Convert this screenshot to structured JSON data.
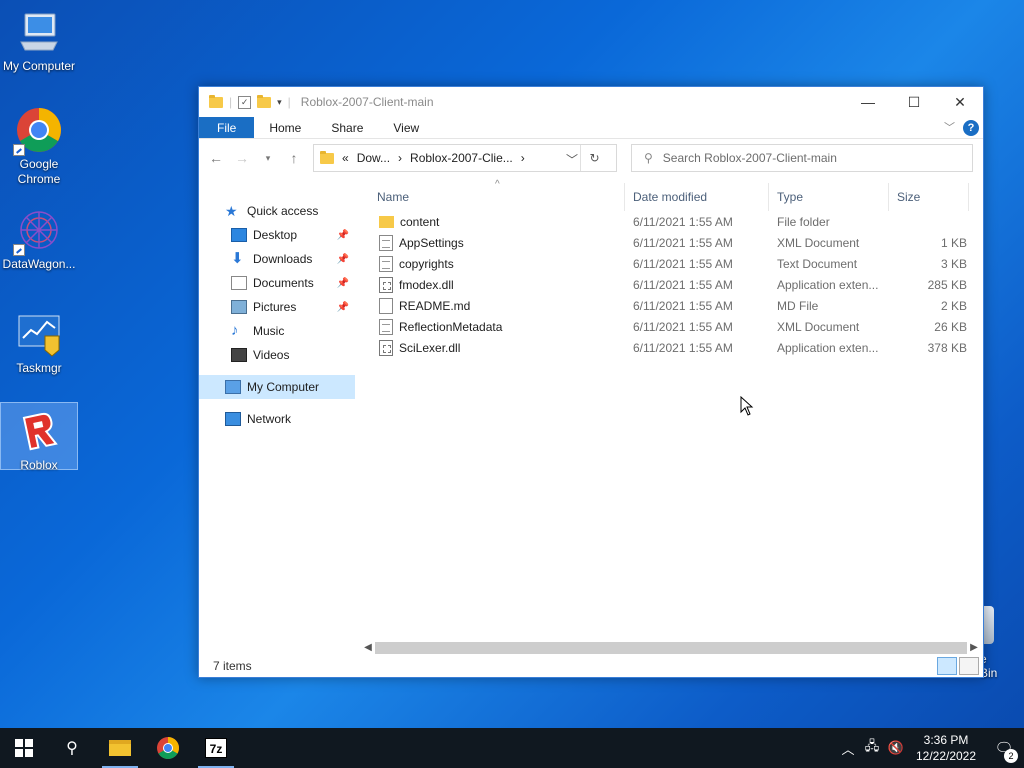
{
  "desktop": {
    "icons": [
      {
        "label": "My Computer",
        "icon": "my-computer-icon"
      },
      {
        "label": "Google Chrome",
        "icon": "chrome-icon"
      },
      {
        "label": "DataWagon...",
        "icon": "datawagon-icon"
      },
      {
        "label": "Taskmgr",
        "icon": "taskmgr-icon"
      },
      {
        "label": "Roblox",
        "icon": "roblox-icon"
      }
    ],
    "recycle_bin_label": "e Bin"
  },
  "window": {
    "title": "Roblox-2007-Client-main",
    "controls": {
      "minimize": "—",
      "maximize": "☐",
      "close": "✕"
    },
    "ribbon_tabs": [
      "File",
      "Home",
      "Share",
      "View"
    ],
    "help": "?",
    "address": {
      "prefix": "«",
      "crumbs": [
        "Dow...",
        "Roblox-2007-Clie..."
      ],
      "sep": "›"
    },
    "search_placeholder": "Search Roblox-2007-Client-main",
    "nav_pane": {
      "quick_access": "Quick access",
      "pinned": [
        "Desktop",
        "Downloads",
        "Documents",
        "Pictures"
      ],
      "unpinned": [
        "Music",
        "Videos"
      ],
      "my_computer": "My Computer",
      "network": "Network"
    },
    "columns": [
      "Name",
      "Date modified",
      "Type",
      "Size"
    ],
    "files": [
      {
        "name": "content",
        "date": "6/11/2021 1:55 AM",
        "type": "File folder",
        "size": "",
        "icon": "folder-icon"
      },
      {
        "name": "AppSettings",
        "date": "6/11/2021 1:55 AM",
        "type": "XML Document",
        "size": "1 KB",
        "icon": "xml-file-icon"
      },
      {
        "name": "copyrights",
        "date": "6/11/2021 1:55 AM",
        "type": "Text Document",
        "size": "3 KB",
        "icon": "text-file-icon"
      },
      {
        "name": "fmodex.dll",
        "date": "6/11/2021 1:55 AM",
        "type": "Application exten...",
        "size": "285 KB",
        "icon": "dll-file-icon"
      },
      {
        "name": "README.md",
        "date": "6/11/2021 1:55 AM",
        "type": "MD File",
        "size": "2 KB",
        "icon": "md-file-icon"
      },
      {
        "name": "ReflectionMetadata",
        "date": "6/11/2021 1:55 AM",
        "type": "XML Document",
        "size": "26 KB",
        "icon": "xml-file-icon"
      },
      {
        "name": "SciLexer.dll",
        "date": "6/11/2021 1:55 AM",
        "type": "Application exten...",
        "size": "378 KB",
        "icon": "dll-file-icon"
      }
    ],
    "status": "7 items"
  },
  "taskbar": {
    "time": "3:36 PM",
    "date": "12/22/2022",
    "notification_count": "2"
  }
}
